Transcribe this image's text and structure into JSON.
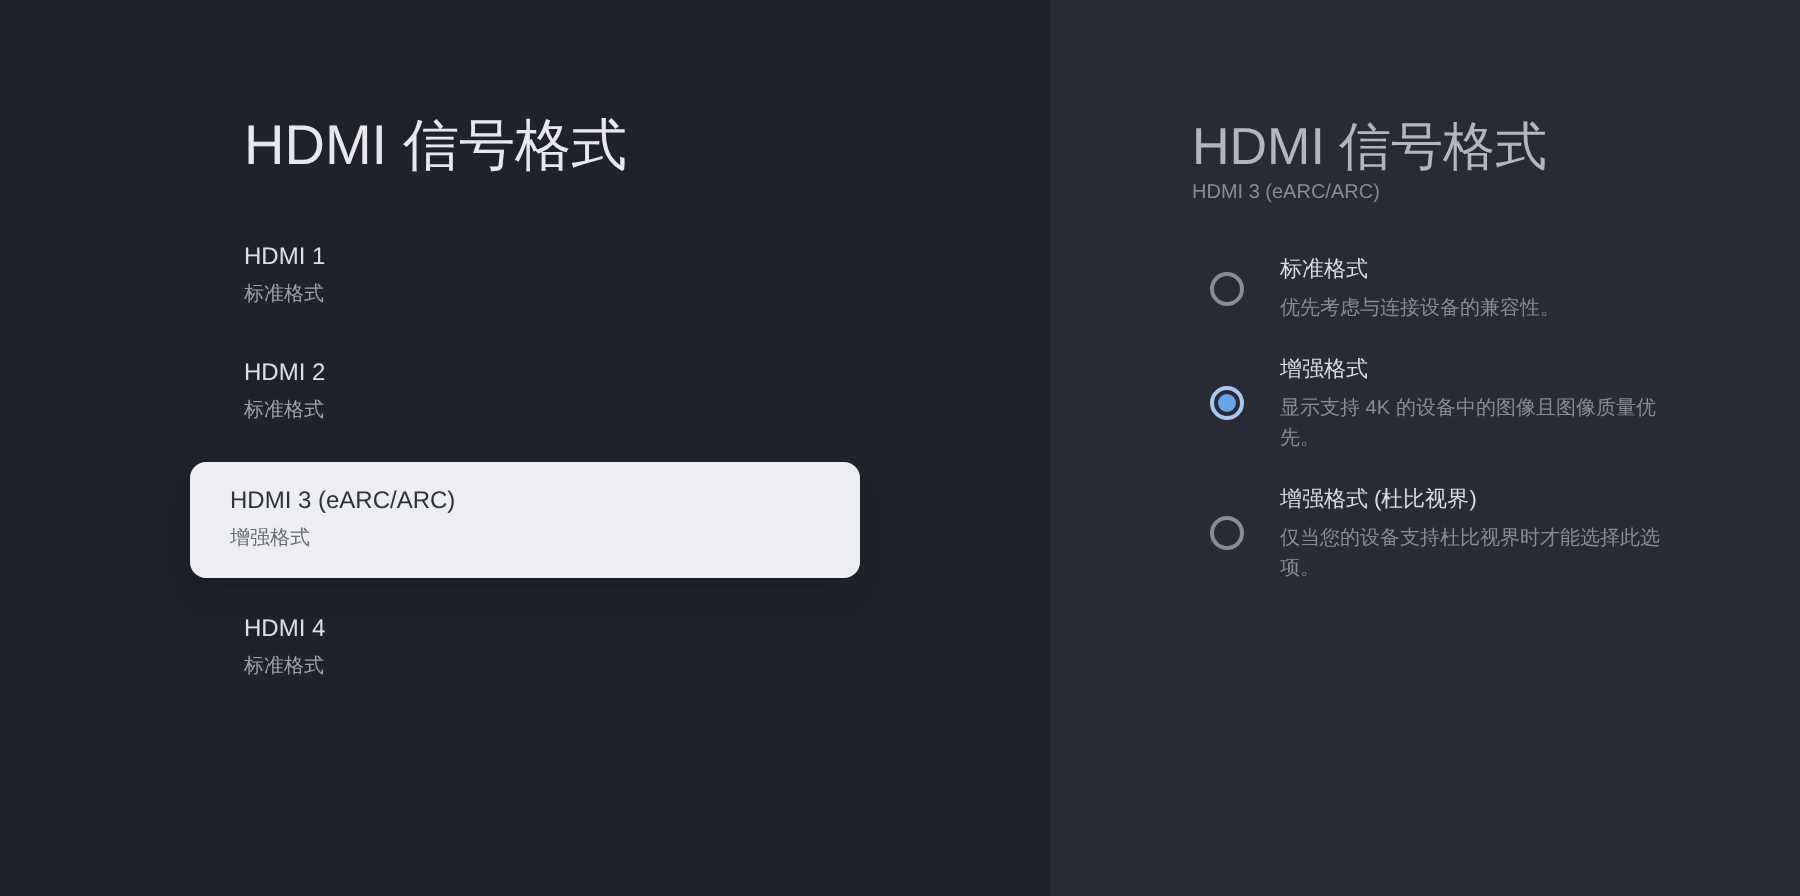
{
  "left_panel": {
    "title": "HDMI 信号格式",
    "items": [
      {
        "name": "HDMI 1",
        "value": "标准格式",
        "selected": false
      },
      {
        "name": "HDMI 2",
        "value": "标准格式",
        "selected": false
      },
      {
        "name": "HDMI 3 (eARC/ARC)",
        "value": "增强格式",
        "selected": true
      },
      {
        "name": "HDMI 4",
        "value": "标准格式",
        "selected": false
      }
    ]
  },
  "right_panel": {
    "title": "HDMI 信号格式",
    "subtitle": "HDMI 3 (eARC/ARC)",
    "options": [
      {
        "label": "标准格式",
        "description": "优先考虑与连接设备的兼容性。",
        "selected": false
      },
      {
        "label": "增强格式",
        "description": "显示支持 4K 的设备中的图像且图像质量优先。",
        "selected": true
      },
      {
        "label": "增强格式 (杜比视界)",
        "description": "仅当您的设备支持杜比视界时才能选择此选项。",
        "selected": false
      }
    ]
  }
}
